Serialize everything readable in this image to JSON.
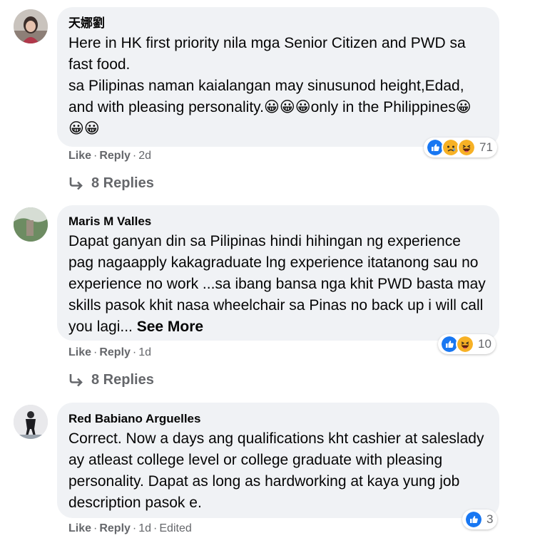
{
  "comments": [
    {
      "author": "天娜劉",
      "text": "Here in HK first priority nila mga Senior Citizen and PWD sa fast food.\nsa Pilipinas naman kaialangan may sinusunod height,Edad, and with pleasing personality.😀😀😀only in the Philippines😀😀😀",
      "like_label": "Like",
      "reply_label": "Reply",
      "time": "2d",
      "reaction_count": "71",
      "replies_label": "8 Replies"
    },
    {
      "author": "Maris M Valles",
      "text": "Dapat ganyan din sa Pilipinas hindi hihingan ng experience pag nagaapply kakagraduate lng experience itatanong sau no experience no work ...sa ibang bansa nga khit PWD basta may skills pasok khit nasa wheelchair sa Pinas no back up i will call you lagi...",
      "see_more": "See More",
      "like_label": "Like",
      "reply_label": "Reply",
      "time": "1d",
      "reaction_count": "10",
      "replies_label": "8 Replies"
    },
    {
      "author": "Red Babiano Arguelles",
      "text": "Correct. Now a days ang qualifications kht cashier at saleslady ay atleast college level or college graduate with pleasing personality. Dapat as long as hardworking at kaya yung job description pasok e.",
      "like_label": "Like",
      "reply_label": "Reply",
      "time": "1d",
      "edited_label": "Edited",
      "reaction_count": "3"
    }
  ],
  "colors": {
    "bubble": "#f0f2f5",
    "secondary_text": "#65676b",
    "like_blue": "#1877f2",
    "reaction_yellow": "#f7b125"
  }
}
